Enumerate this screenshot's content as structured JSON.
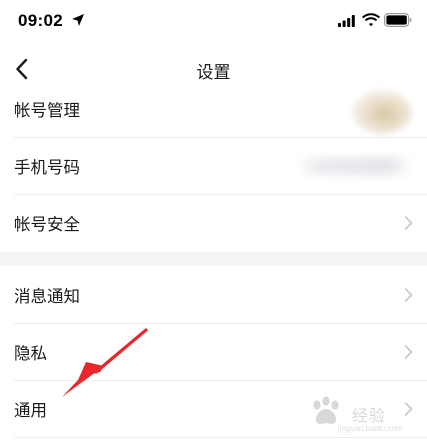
{
  "status_bar": {
    "time": "09:02",
    "location_icon": "location-arrow-icon",
    "signal_icon": "cellular-signal-icon",
    "wifi_icon": "wifi-icon",
    "battery_icon": "battery-icon"
  },
  "nav": {
    "back_icon": "chevron-left-icon",
    "title": "设置"
  },
  "groups": [
    {
      "items": [
        {
          "label": "帐号管理",
          "trailing": "avatar"
        },
        {
          "label": "手机号码",
          "trailing": "blurred-phone-number"
        },
        {
          "label": "帐号安全",
          "trailing": "chevron-right-icon"
        }
      ]
    },
    {
      "items": [
        {
          "label": "消息通知",
          "trailing": "chevron-right-icon"
        },
        {
          "label": "隐私",
          "trailing": "chevron-right-icon"
        },
        {
          "label": "通用",
          "trailing": "chevron-right-icon"
        }
      ]
    }
  ],
  "annotation": {
    "arrow_color": "#e8262b",
    "points_to": "通用"
  },
  "watermark": {
    "logo": "baidu-paw-logo",
    "text": "经验",
    "sub": "jingyan.baidu.com"
  },
  "colors": {
    "background": "#ffffff",
    "group_gap": "#f5f5f7",
    "divider": "#ececec",
    "chevron": "#c7c7cc"
  }
}
